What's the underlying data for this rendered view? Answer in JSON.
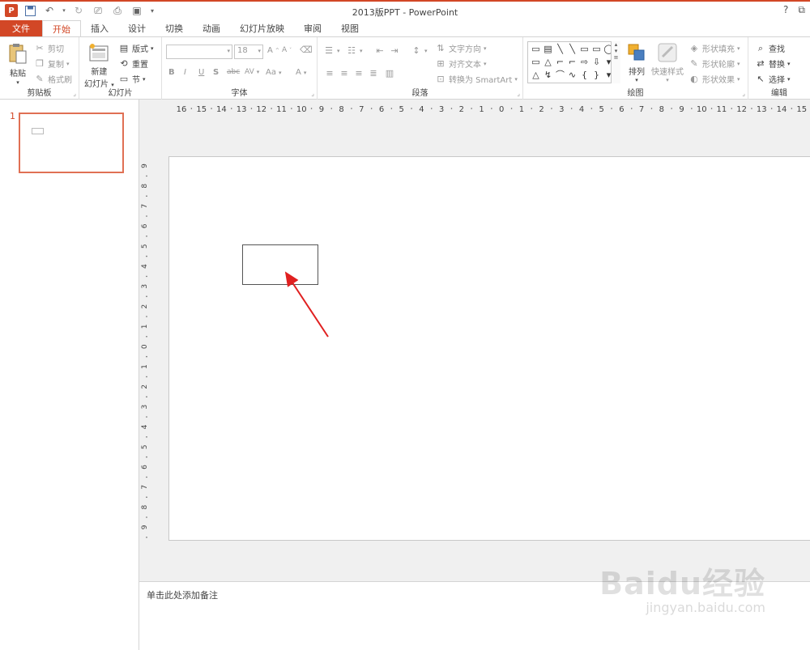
{
  "window": {
    "title": "2013版PPT - PowerPoint",
    "help": "?",
    "restore": "⧉"
  },
  "qat": {
    "app_logo": "P",
    "save_icon": "save-icon",
    "undo_icon": "undo-icon",
    "redo_icon": "redo-icon"
  },
  "tabs": [
    {
      "label": "文件",
      "active": false,
      "file": true
    },
    {
      "label": "开始",
      "active": true
    },
    {
      "label": "插入"
    },
    {
      "label": "设计"
    },
    {
      "label": "切换"
    },
    {
      "label": "动画"
    },
    {
      "label": "幻灯片放映"
    },
    {
      "label": "审阅"
    },
    {
      "label": "视图"
    }
  ],
  "ribbon": {
    "clipboard": {
      "label": "剪贴板",
      "paste": "粘贴",
      "cut": "剪切",
      "copy": "复制",
      "format_painter": "格式刷"
    },
    "slides": {
      "label": "幻灯片",
      "new_slide_1": "新建",
      "new_slide_2": "幻灯片",
      "layout": "版式",
      "reset": "重置",
      "section": "节"
    },
    "font": {
      "label": "字体",
      "font_name": "",
      "font_size": "18",
      "bold": "B",
      "italic": "I",
      "underline": "U",
      "shadow": "S",
      "strike": "abc",
      "spacing": "AV",
      "case": "Aa",
      "color": "A",
      "grow": "A",
      "shrink": "A"
    },
    "paragraph": {
      "label": "段落",
      "text_direction": "文字方向",
      "align_text": "对齐文本",
      "smartart": "转换为 SmartArt"
    },
    "drawing": {
      "label": "绘图",
      "arrange": "排列",
      "quick_styles": "快速样式",
      "shape_fill": "形状填充",
      "shape_outline": "形状轮廓",
      "shape_effects": "形状效果",
      "shapes": [
        "▭",
        "▤",
        "╲",
        "╲",
        "▭",
        "▭",
        "◯",
        "▭",
        "△",
        "⌐",
        "⌐",
        "⇨",
        "⇩",
        "▾",
        "△",
        "↯",
        "⌒",
        "∿",
        "{",
        "}",
        "▾"
      ]
    },
    "editing": {
      "label": "编辑",
      "find": "查找",
      "replace": "替换",
      "select": "选择"
    }
  },
  "ruler": {
    "h_labels": [
      "16",
      "15",
      "14",
      "13",
      "12",
      "11",
      "10",
      "9",
      "8",
      "7",
      "6",
      "5",
      "4",
      "3",
      "2",
      "1",
      "0",
      "1",
      "2",
      "3",
      "4",
      "5",
      "6",
      "7",
      "8",
      "9",
      "10",
      "11",
      "12",
      "13",
      "14",
      "15"
    ],
    "v_labels": [
      "9",
      "8",
      "7",
      "6",
      "5",
      "4",
      "3",
      "2",
      "1",
      "0",
      "1",
      "2",
      "3",
      "4",
      "5",
      "6",
      "7",
      "8",
      "9"
    ]
  },
  "thumbnails": [
    {
      "number": "1"
    }
  ],
  "notes": {
    "placeholder": "单击此处添加备注"
  },
  "watermark": {
    "logo": "Baidu经验",
    "url": "jingyan.baidu.com"
  },
  "colors": {
    "accent": "#d24726",
    "thumb_border": "#e07054",
    "arrow": "#e02020"
  }
}
